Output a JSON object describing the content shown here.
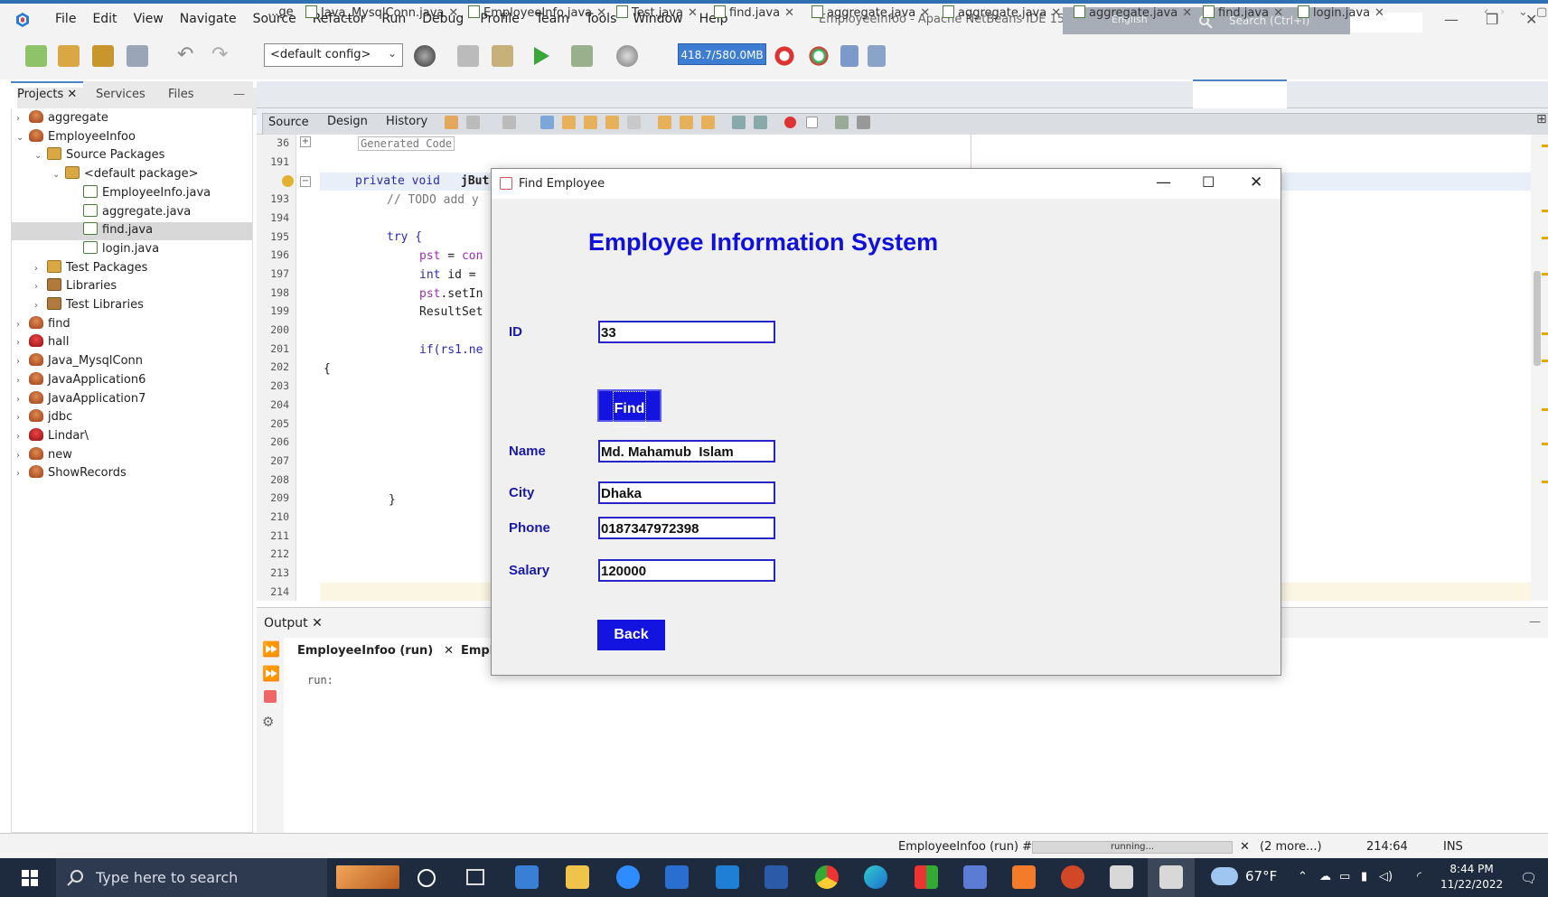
{
  "window": {
    "title": "EmployeeInfoo - Apache NetBeans IDE 15",
    "menu": [
      "File",
      "Edit",
      "View",
      "Navigate",
      "Source",
      "Refactor",
      "Run",
      "Debug",
      "Profile",
      "Team",
      "Tools",
      "Window",
      "Help"
    ],
    "search_lang": "English",
    "search_placeholder": "Search (Ctrl+I)"
  },
  "toolbar": {
    "config": "<default config>",
    "memory": "418.7/580.0MB"
  },
  "projects": {
    "tabs": [
      "Projects",
      "Services",
      "Files"
    ],
    "tree": [
      {
        "label": "aggregate",
        "depth": 0,
        "arrow": "›",
        "icon": "cup"
      },
      {
        "label": "EmployeeInfoo",
        "depth": 0,
        "arrow": "⌄",
        "icon": "cup"
      },
      {
        "label": "Source Packages",
        "depth": 1,
        "arrow": "⌄",
        "icon": "pkg"
      },
      {
        "label": "<default package>",
        "depth": 2,
        "arrow": "⌄",
        "icon": "pkg"
      },
      {
        "label": "EmployeeInfo.java",
        "depth": 3,
        "arrow": "",
        "icon": "java"
      },
      {
        "label": "aggregate.java",
        "depth": 3,
        "arrow": "",
        "icon": "java"
      },
      {
        "label": "find.java",
        "depth": 3,
        "arrow": "",
        "icon": "java"
      },
      {
        "label": "login.java",
        "depth": 3,
        "arrow": "",
        "icon": "java"
      },
      {
        "label": "Test Packages",
        "depth": 1,
        "arrow": "›",
        "icon": "pkg"
      },
      {
        "label": "Libraries",
        "depth": 1,
        "arrow": "›",
        "icon": "lib"
      },
      {
        "label": "Test Libraries",
        "depth": 1,
        "arrow": "›",
        "icon": "lib"
      },
      {
        "label": "find",
        "depth": 0,
        "arrow": "›",
        "icon": "cup"
      },
      {
        "label": "hall",
        "depth": 0,
        "arrow": "›",
        "icon": "cupred"
      },
      {
        "label": "Java_MysqlConn",
        "depth": 0,
        "arrow": "›",
        "icon": "cup"
      },
      {
        "label": "JavaApplication6",
        "depth": 0,
        "arrow": "›",
        "icon": "cup"
      },
      {
        "label": "JavaApplication7",
        "depth": 0,
        "arrow": "›",
        "icon": "cup"
      },
      {
        "label": "jdbc",
        "depth": 0,
        "arrow": "›",
        "icon": "cup"
      },
      {
        "label": "Lindar\\",
        "depth": 0,
        "arrow": "›",
        "icon": "cupred"
      },
      {
        "label": "new",
        "depth": 0,
        "arrow": "›",
        "icon": "cup"
      },
      {
        "label": "ShowRecords",
        "depth": 0,
        "arrow": "›",
        "icon": "cup"
      }
    ]
  },
  "editor": {
    "tabs": [
      "...ge",
      "Java_MysqlConn.java",
      "EmployeeInfo.java",
      "Test.java",
      "find.java",
      "aggregate.java",
      "aggregate.java",
      "aggregate.java",
      "find.java",
      "login.java"
    ],
    "source_bar": [
      "Source",
      "Design",
      "History"
    ],
    "lines": [
      "36",
      "191",
      "",
      "193",
      "194",
      "195",
      "196",
      "197",
      "198",
      "199",
      "200",
      "201",
      "202",
      "203",
      "204",
      "205",
      "206",
      "207",
      "208",
      "209",
      "210",
      "211",
      "212",
      "213",
      "214"
    ],
    "code": {
      "generated": "Generated Code",
      "l192a": "private void ",
      "l192b": "jBut",
      "l193": "// TODO add y",
      "l195": "try {",
      "l196a": "pst",
      "l196b": " = ",
      "l196c": "con",
      "l197a": "int",
      "l197b": " id =",
      "l198a": "pst",
      "l198b": ".setIn",
      "l199": "ResultSet",
      "l201": "if(rs1.ne",
      "l202": "{",
      "l209": "}"
    }
  },
  "output": {
    "tab": "Output",
    "subtabs": [
      "EmployeeInfoo (run)",
      "Empl"
    ],
    "text": "run:"
  },
  "status": {
    "task": "EmployeeInfoo (run) #3",
    "progress": "running...",
    "more": "(2 more...)",
    "position": "214:64",
    "mode": "INS"
  },
  "taskbar": {
    "search": "Type here to search",
    "weather": "67°F",
    "time": "8:44 PM",
    "date": "11/22/2022"
  },
  "dialog": {
    "title": "Find Employee",
    "heading": "Employee Information System",
    "id_label": "ID",
    "id_value": "33",
    "find_button": "Find",
    "name_label": "Name",
    "name_value": "Md. Mahamub  Islam",
    "city_label": "City",
    "city_value": "Dhaka",
    "phone_label": "Phone",
    "phone_value": "0187347972398",
    "salary_label": "Salary",
    "salary_value": "120000",
    "back_button": "Back"
  }
}
